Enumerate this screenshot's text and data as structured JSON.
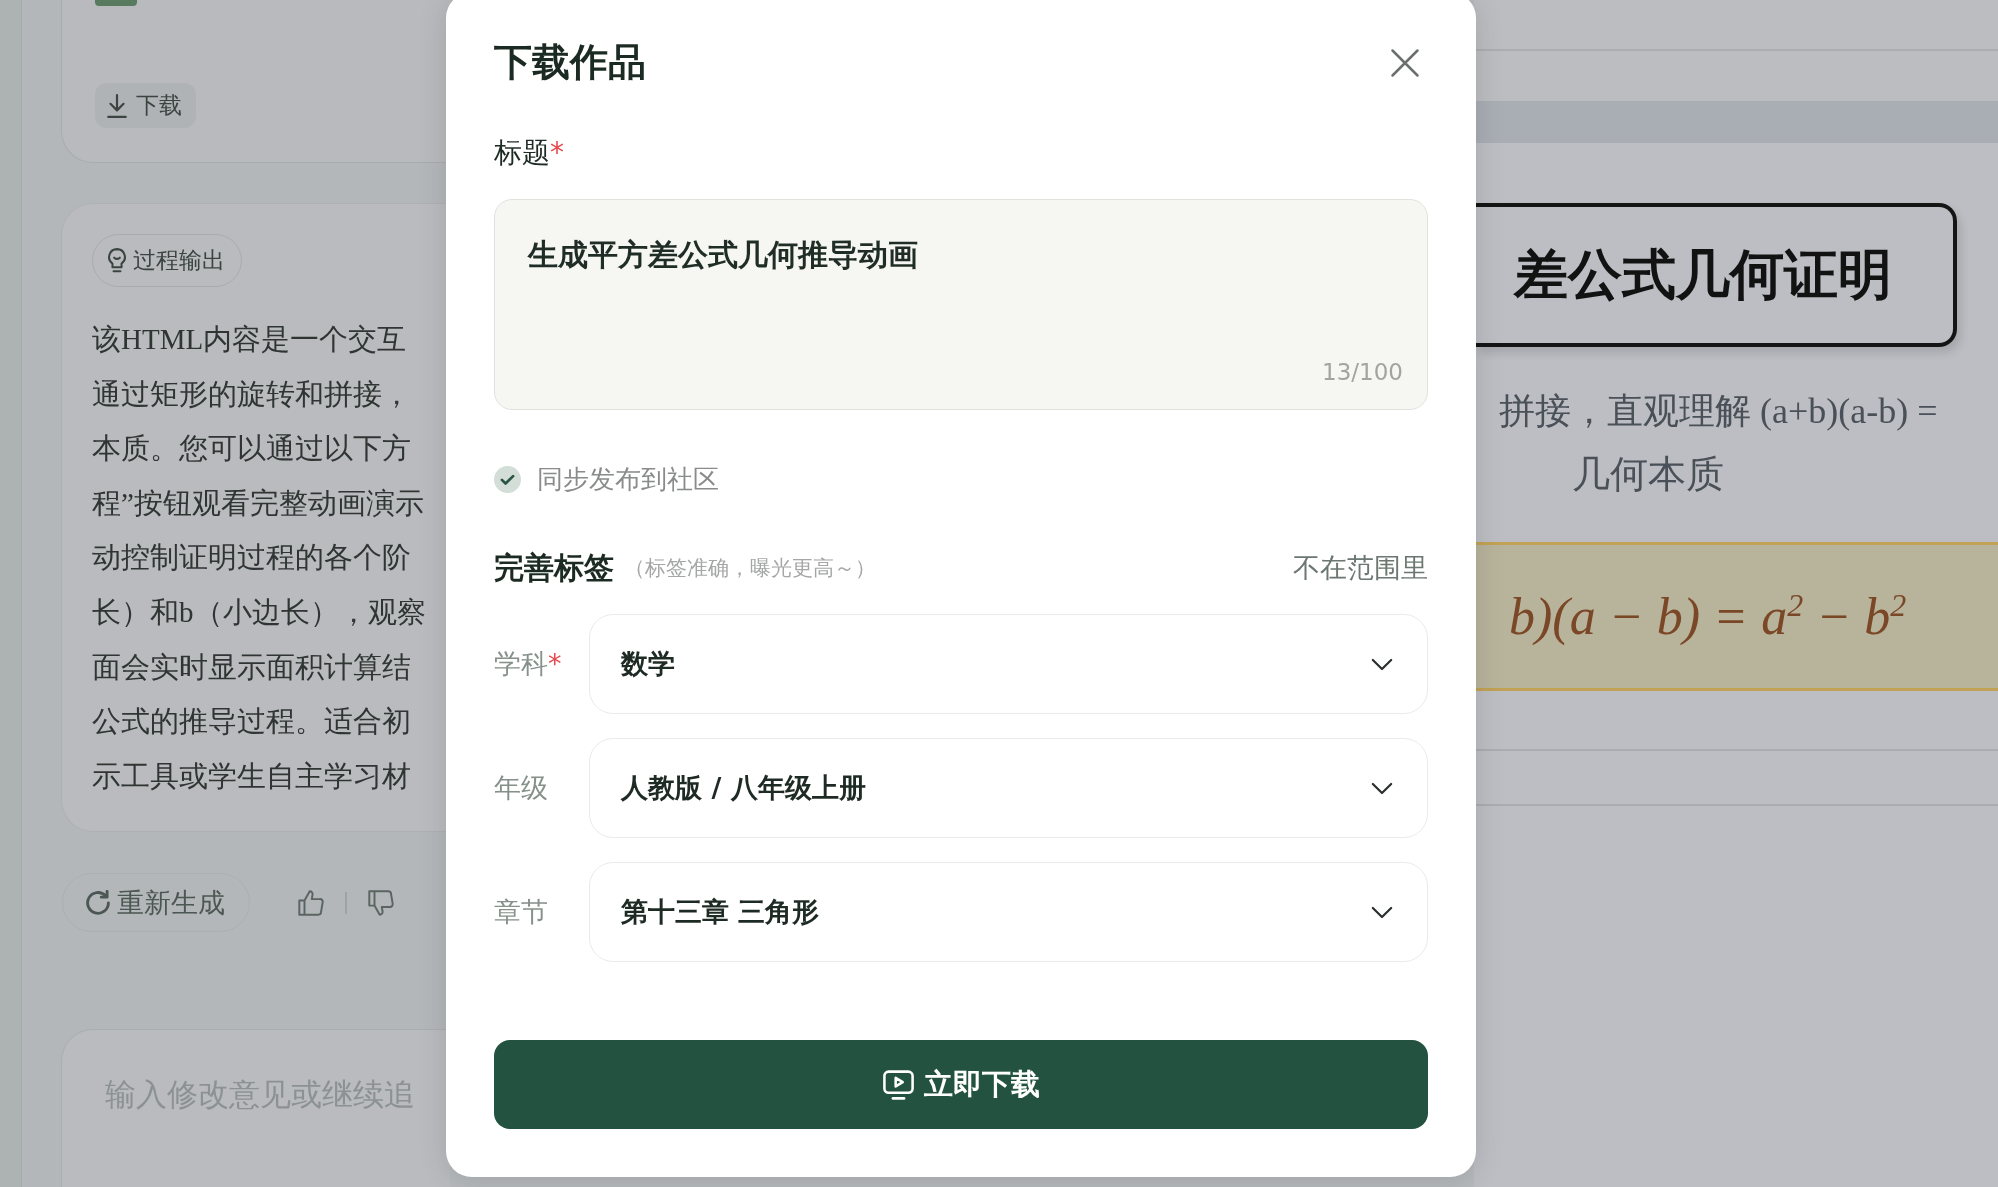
{
  "background": {
    "left_panel": {
      "download_button": {
        "label": "下载"
      },
      "process_chip": {
        "label": "过程输出"
      },
      "description_lines": [
        "该HTML内容是一个交互",
        "通过矩形的旋转和拼接，",
        "本质。您可以通过以下方",
        "程”按钮观看完整动画演示",
        "动控制证明过程的各个阶",
        "长）和b（小边长），观察",
        "面会实时显示面积计算结",
        "公式的推导过程。适合初",
        "示工具或学生自主学习材"
      ],
      "regenerate_button": {
        "label": "重新生成"
      },
      "message_input": {
        "placeholder": "输入修改意见或继续追"
      }
    },
    "right_panel": {
      "banner_title": "差公式几何证明",
      "subtitle_lines": [
        "拼接，直观理解 (a+b)(a-b) =",
        "几何本质"
      ],
      "formula": "b)(a − b) = a$^{2}$ − b$^{2}$"
    }
  },
  "dialog": {
    "title": "下载作品",
    "title_field": {
      "label": "标题",
      "required_mark": "*",
      "value": "生成平方差公式几何推导动画",
      "counter": "13/100"
    },
    "sync_option": {
      "label": "同步发布到社区",
      "checked": true
    },
    "tags": {
      "heading": "完善标签",
      "hint": "（标签准确，曝光更高～）",
      "link": "不在范围里",
      "fields": [
        {
          "label": "学科",
          "required_mark": "*",
          "value": "数学"
        },
        {
          "label": "年级",
          "value": "人教版 / 八年级上册"
        },
        {
          "label": "章节",
          "value": "第十三章 三角形"
        }
      ]
    },
    "download_button": {
      "label": "立即下载"
    }
  }
}
